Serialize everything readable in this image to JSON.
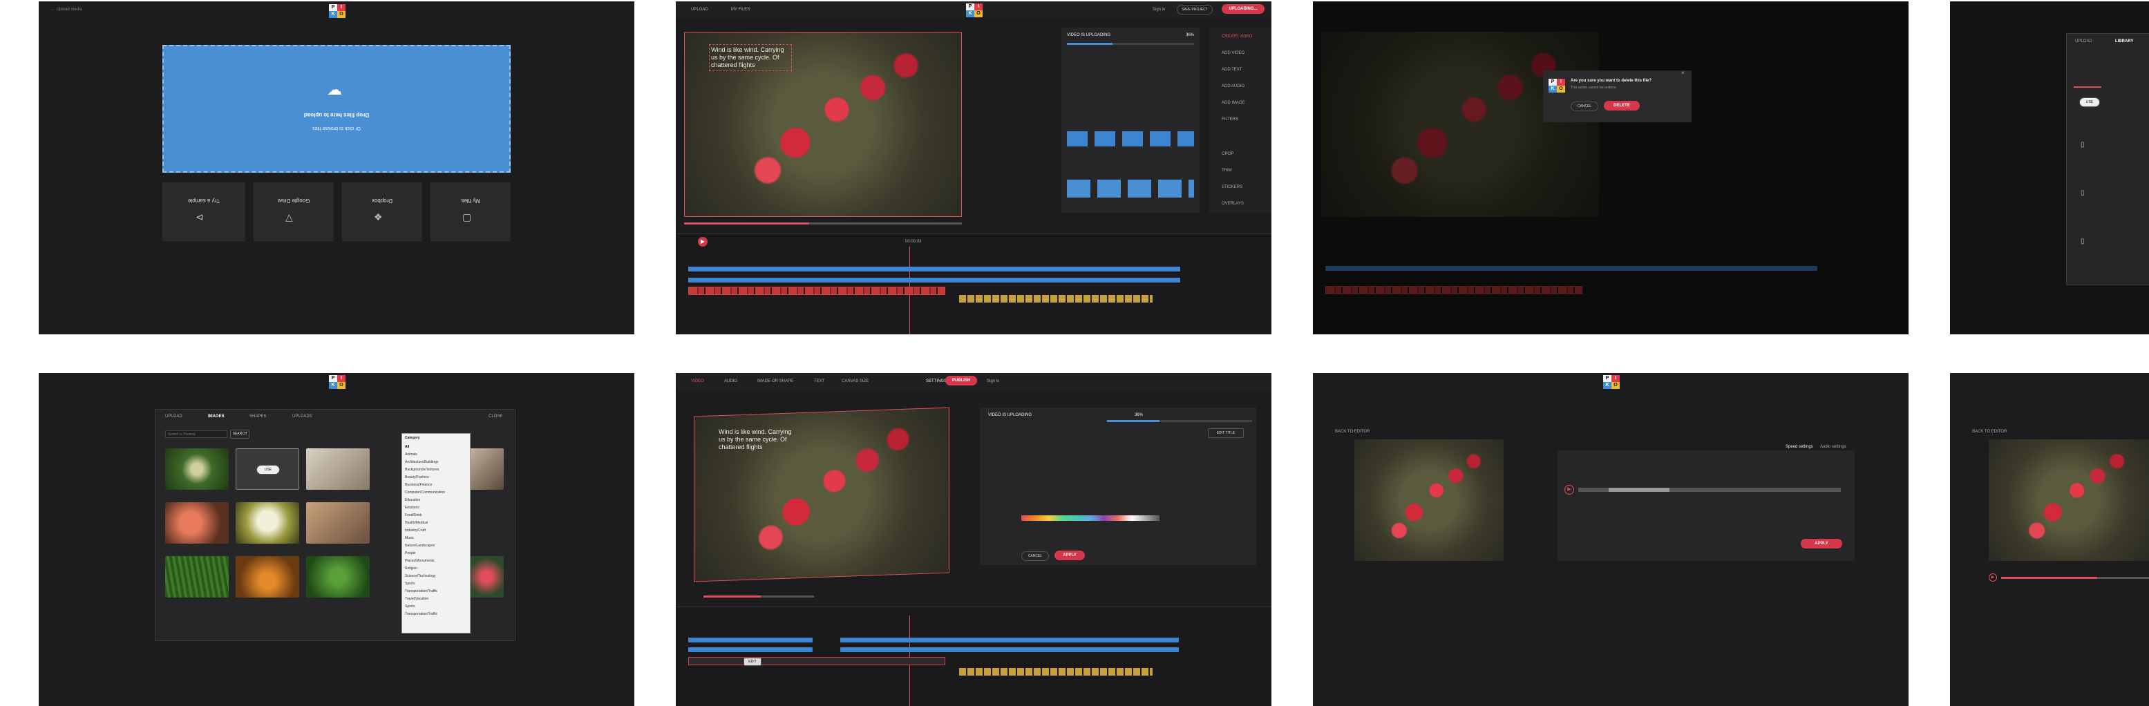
{
  "upload_screen": {
    "back_label": "← Upload media",
    "drop_title": "Drop files here to upload",
    "drop_subtitle": "Or click to browse files",
    "sources": [
      {
        "label": "My files",
        "icon": "folder-icon"
      },
      {
        "label": "Dropbox",
        "icon": "dropbox-icon"
      },
      {
        "label": "Google Drive",
        "icon": "google-drive-icon"
      },
      {
        "label": "Try a sample",
        "icon": "sample-icon"
      }
    ]
  },
  "editor": {
    "toolbar": {
      "upload": "UPLOAD",
      "my_files": "MY FILES",
      "sign_in": "Sign in",
      "save_project": "SAVE PROJECT",
      "uploading": "UPLOADING..."
    },
    "caption": "Wind is like wind. Carrying us by the same cycle. Of chattered flights",
    "status": {
      "title": "VIDEO IS UPLOADING",
      "percent": "36%"
    },
    "side_menu": [
      "CREATE VIDEO",
      "ADD VIDEO",
      "ADD TEXT",
      "ADD AUDIO",
      "ADD IMAGE",
      "FILTERS",
      "CROP",
      "TRIM",
      "STICKERS",
      "OVERLAYS"
    ],
    "timecode": "00:00:03"
  },
  "confirm_dialog": {
    "question": "Are you sure you want to delete this file?",
    "subtext": "This action cannot be undone.",
    "cancel": "CANCEL",
    "delete": "DELETE"
  },
  "library_panel": {
    "tabs": [
      "UPLOAD",
      "LIBRARY"
    ],
    "use_label": "USE"
  },
  "image_picker": {
    "tabs": [
      "UPLOAD",
      "IMAGES",
      "SHAPES",
      "UPLOADS"
    ],
    "close_label": "CLOSE",
    "search_placeholder": "Search in Pixabay",
    "search_button": "SEARCH",
    "dropdown_title": "Category",
    "categories": [
      "All",
      "Animals",
      "Architecture/Buildings",
      "Backgrounds/Textures",
      "Beauty/Fashion",
      "Business/Finance",
      "Computer/Communication",
      "Education",
      "Emotions",
      "Food/Drink",
      "Health/Medical",
      "Industry/Craft",
      "Music",
      "Nature/Landscapes",
      "People",
      "Places/Monuments",
      "Religion",
      "Science/Technology",
      "Sports",
      "Transportation/Traffic",
      "Travel/Vacation",
      "Sports",
      "Transportation/Traffic"
    ],
    "use_label": "USE"
  },
  "editor_settings": {
    "toolbar": [
      "VIDEO",
      "AUDIO",
      "IMAGE OR SHAPE",
      "TEXT",
      "CANVAS SIZE"
    ],
    "settings": "SETTINGS",
    "publish": "PUBLISH",
    "sign_in": "Sign in",
    "status": {
      "title": "VIDEO IS UPLOADING",
      "percent": "36%"
    },
    "edit_title": "EDIT TITLE",
    "cancel": "CANCEL",
    "apply": "APPLY",
    "edit_label": "EDIT"
  },
  "speed_screen": {
    "back_label": "BACK TO EDITOR",
    "tabs": [
      "Speed settings",
      "Audio settings"
    ],
    "apply": "APPLY"
  },
  "partial_screen": {
    "back_label": "BACK TO EDITOR"
  },
  "colors": {
    "accent_blue": "#4a8fd4",
    "accent_red": "#d6384b",
    "panel_bg": "#1c1c1e"
  }
}
